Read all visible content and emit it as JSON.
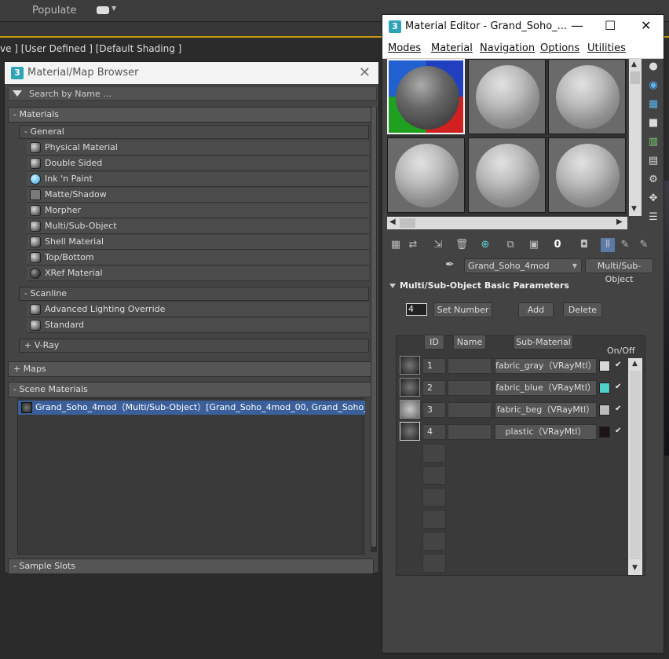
{
  "background": {
    "populate_label": "Populate",
    "viewport_label": "ve ] [User Defined ] [Default Shading ]"
  },
  "browser": {
    "title": "Material/Map Browser",
    "search_placeholder": "Search by Name ...",
    "categories": {
      "materials": "- Materials",
      "general": "- General",
      "scanline": "- Scanline",
      "vray": "+ V-Ray",
      "maps": "+ Maps",
      "scene_materials": "- Scene Materials",
      "sample_slots": "- Sample Slots"
    },
    "general_items": [
      "Physical Material",
      "Double Sided",
      "Ink 'n Paint",
      "Matte/Shadow",
      "Morpher",
      "Multi/Sub-Object",
      "Shell Material",
      "Top/Bottom",
      "XRef Material"
    ],
    "scanline_items": [
      "Advanced Lighting Override",
      "Standard"
    ],
    "scene_item": "Grand_Soho_4mod（Multi/Sub-Object）[Grand_Soho_4mod_00, Grand_Soho_..."
  },
  "editor": {
    "title": "Material Editor - Grand_Soho_...",
    "menu": [
      "Modes",
      "Material",
      "Navigation",
      "Options",
      "Utilities"
    ],
    "material_name": "Grand_Soho_4mod",
    "material_type": "Multi/Sub-Object",
    "rollout_title": "Multi/Sub-Object Basic Parameters",
    "set_number_value": "4",
    "set_number_label": "Set Number",
    "add_label": "Add",
    "delete_label": "Delete",
    "columns": {
      "id": "ID",
      "name": "Name",
      "sub_material": "Sub-Material",
      "on_off": "On/Off"
    },
    "rows": [
      {
        "id": "1",
        "sub": "fabric_gray（VRayMtl）",
        "color": "#d8d8d8",
        "on": "✔"
      },
      {
        "id": "2",
        "sub": "fabric_blue（VRayMtl）",
        "color": "#4fcfc8",
        "on": "✔"
      },
      {
        "id": "3",
        "sub": "fabric_beg（VRayMtl）",
        "color": "#bcbcbc",
        "on": "✔"
      },
      {
        "id": "4",
        "sub": "plastic（VRayMtl）",
        "color": "#1e1616",
        "on": "✔"
      }
    ]
  }
}
